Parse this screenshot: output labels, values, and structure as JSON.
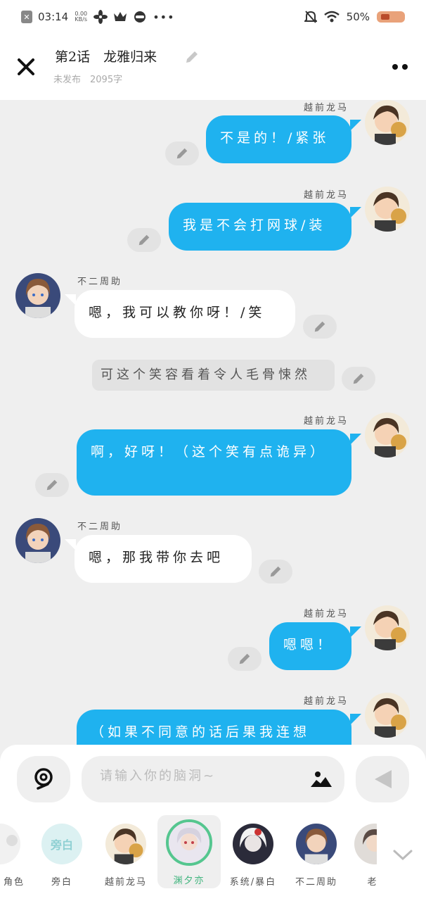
{
  "status_bar": {
    "time": "03:14",
    "speed_value": "0.00",
    "speed_unit": "KB/s",
    "battery": "50%"
  },
  "header": {
    "title": "第2话　龙雅归来",
    "subtitle": "未发布　2095字"
  },
  "messages": [
    {
      "side": "right",
      "speaker": "越前龙马",
      "text": "不是的！/紧张"
    },
    {
      "side": "right",
      "speaker": "越前龙马",
      "text": "我是不会打网球/装"
    },
    {
      "side": "left",
      "speaker": "不二周助",
      "text": "嗯，我可以教你呀！/笑"
    },
    {
      "side": "narration",
      "speaker": "",
      "text": "可这个笑容看着令人毛骨悚然"
    },
    {
      "side": "right",
      "speaker": "越前龙马",
      "text": "啊，好呀！（这个笑有点诡异）"
    },
    {
      "side": "left",
      "speaker": "不二周助",
      "text": "嗯，那我带你去吧"
    },
    {
      "side": "right",
      "speaker": "越前龙马",
      "text": "嗯嗯！"
    },
    {
      "side": "right",
      "speaker": "越前龙马",
      "text": "（如果不同意的话后果我连想"
    }
  ],
  "composer": {
    "placeholder": "请输入你的脑洞~",
    "value": ""
  },
  "roles": [
    {
      "label": "角色"
    },
    {
      "label": "旁白",
      "avatar_text": "旁白"
    },
    {
      "label": "越前龙马"
    },
    {
      "label": "渊夕亦",
      "active": true
    },
    {
      "label": "系统/暴白"
    },
    {
      "label": "不二周助"
    },
    {
      "label": "老"
    }
  ],
  "colors": {
    "accent_blue": "#1fb2ef",
    "active_green": "#55c68f",
    "background": "#efefef"
  },
  "icons": [
    "close-icon",
    "edit-pencil-icon",
    "more-dots-icon",
    "voice-icon",
    "image-icon",
    "send-icon",
    "chevron-down-icon"
  ]
}
